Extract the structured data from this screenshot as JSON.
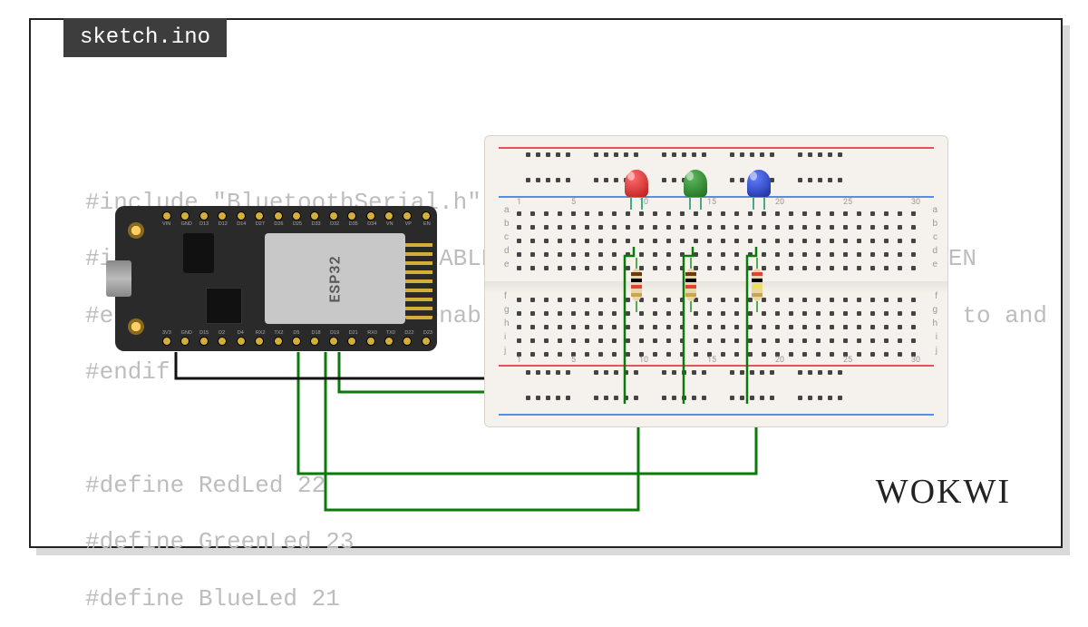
{
  "tab": {
    "filename": "sketch.ino"
  },
  "brand": "WOKWI",
  "code": {
    "line1": "#include \"BluetoothSerial.h\"",
    "line2": "#if !defined(CONFIG_BT_ENABLED) || !defined(CONFIG_BLUEDROID_EN",
    "line3": "#error Bluetooth is not enabled! Please run `make menuconfig` to and",
    "line4": "#endif",
    "line5": "",
    "line6": "#define RedLed 22",
    "line7": "#define GreenLed 23",
    "line8": "#define BlueLed 21"
  },
  "board": {
    "name": "ESP32",
    "pins_top": [
      "VIN",
      "GND",
      "D13",
      "D12",
      "D14",
      "D27",
      "D26",
      "D25",
      "D33",
      "D32",
      "D35",
      "D34",
      "VN",
      "VP",
      "EN"
    ],
    "pins_bot": [
      "3V3",
      "GND",
      "D15",
      "D2",
      "D4",
      "RX2",
      "TX2",
      "D5",
      "D18",
      "D19",
      "D21",
      "RX0",
      "TX0",
      "D22",
      "D23"
    ]
  },
  "breadboard": {
    "rows_upper": [
      "a",
      "b",
      "c",
      "d",
      "e"
    ],
    "rows_lower": [
      "f",
      "g",
      "h",
      "i",
      "j"
    ],
    "col_markers": [
      "1",
      "5",
      "10",
      "15",
      "20",
      "25",
      "30"
    ]
  },
  "leds": [
    {
      "name": "led-red",
      "color": "#d32"
    },
    {
      "name": "led-green",
      "color": "#2a7"
    },
    {
      "name": "led-blue",
      "color": "#24d"
    }
  ],
  "resistors": [
    {
      "name": "resistor-1",
      "bands": [
        "#6b3a0f",
        "#000",
        "#d43",
        "#caa450"
      ]
    },
    {
      "name": "resistor-2",
      "bands": [
        "#6b3a0f",
        "#000",
        "#d43",
        "#caa450"
      ]
    },
    {
      "name": "resistor-3",
      "bands": [
        "#d43",
        "#000",
        "#ede24a",
        "#caa450"
      ]
    }
  ],
  "wires": {
    "gnd": "black",
    "signal": "green"
  }
}
